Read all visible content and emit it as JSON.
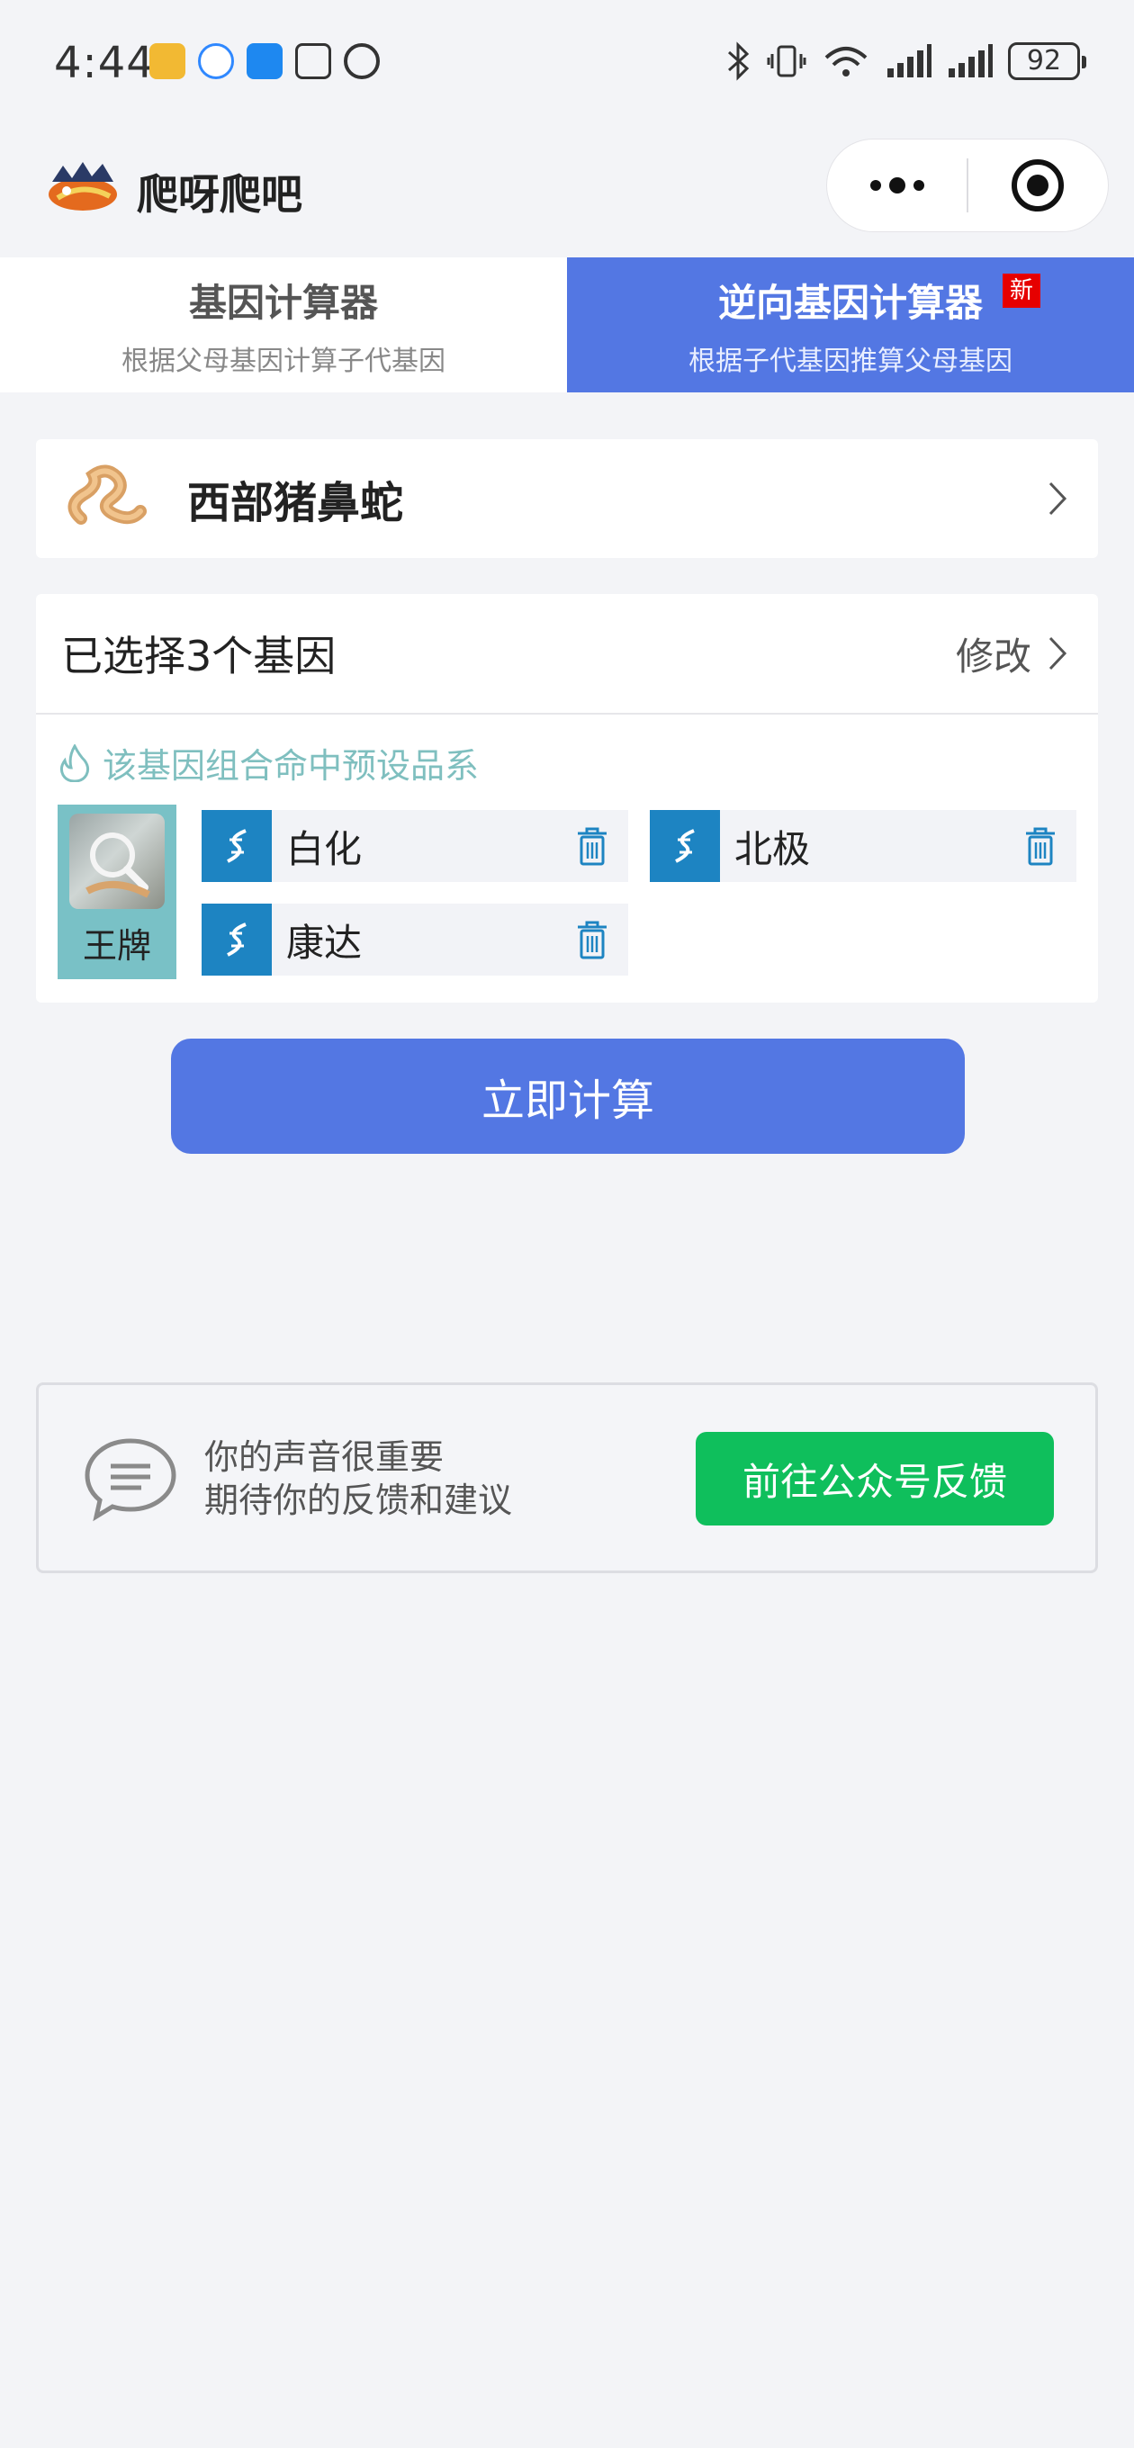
{
  "status_bar": {
    "time": "4:44",
    "battery": "92"
  },
  "app": {
    "title": "爬呀爬吧"
  },
  "tabs": [
    {
      "title": "基因计算器",
      "subtitle": "根据父母基因计算子代基因",
      "active": false
    },
    {
      "title": "逆向基因计算器",
      "subtitle": "根据子代基因推算父母基因",
      "active": true,
      "badge": "新"
    }
  ],
  "species": {
    "name": "西部猪鼻蛇"
  },
  "genes": {
    "title": "已选择3个基因",
    "modify_label": "修改",
    "preset_text": "该基因组合命中预设品系",
    "morph_label": "王牌",
    "items": [
      {
        "name": "白化"
      },
      {
        "name": "北极"
      },
      {
        "name": "康达"
      }
    ]
  },
  "actions": {
    "calculate_label": "立即计算"
  },
  "feedback": {
    "line1": "你的声音很重要",
    "line2": "期待你的反馈和建议",
    "button_label": "前往公众号反馈"
  },
  "colors": {
    "primary": "#5377e3",
    "gene_icon": "#1d84c2",
    "morph_bg": "#79c1c6",
    "feedback_button": "#0fbf5c",
    "badge": "#e60000"
  }
}
